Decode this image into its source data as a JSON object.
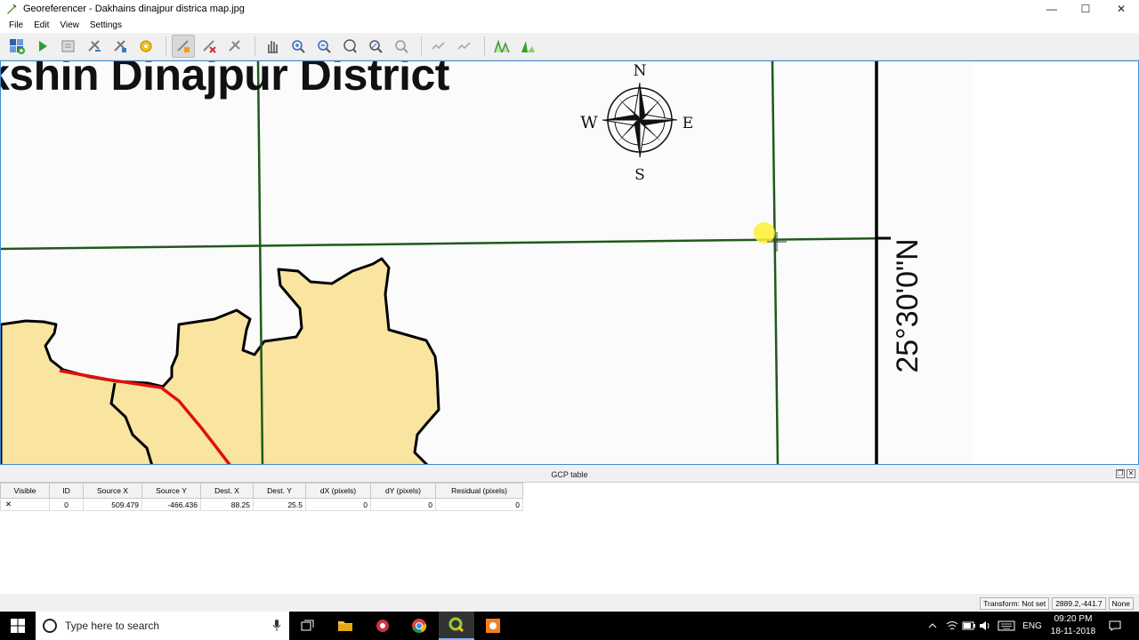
{
  "window": {
    "title": "Georeferencer - Dakhains dinajpur districa map.jpg",
    "minimize_glyph": "—",
    "maximize_glyph": "☐",
    "close_glyph": "✕"
  },
  "menu": [
    "File",
    "Edit",
    "View",
    "Settings"
  ],
  "toolbar_icons": [
    "open-raster-icon",
    "start-georeferencing-icon",
    "generate-gdal-script-icon",
    "load-gcp-icon",
    "save-gcp-icon",
    "transformation-settings-icon",
    "add-point-icon",
    "delete-point-icon",
    "move-gcp-icon",
    "pan-icon",
    "zoom-in-icon",
    "zoom-out-icon",
    "zoom-to-layer-icon",
    "zoom-last-icon",
    "zoom-next-icon",
    "link-georeferencer-icon",
    "link-qgis-icon",
    "full-histogram-stretch-icon",
    "local-histogram-stretch-icon"
  ],
  "map": {
    "title_text": "kshin Dinajpur District",
    "compass": {
      "n": "N",
      "s": "S",
      "e": "E",
      "w": "W"
    },
    "latitude_label": "25°30'0\"N",
    "colors": {
      "grid": "#1f5a1a",
      "district_fill": "#f9e4a0",
      "boundary": "#000000",
      "river": "#e01010",
      "cursor_highlight": "#ffee33"
    }
  },
  "gcp_panel": {
    "title": "GCP table",
    "columns": [
      "Visible",
      "ID",
      "Source X",
      "Source Y",
      "Dest. X",
      "Dest. Y",
      "dX (pixels)",
      "dY (pixels)",
      "Residual (pixels)"
    ],
    "rows": [
      {
        "visible": "✕",
        "id": "0",
        "source_x": "509.479",
        "source_y": "-466.436",
        "dest_x": "88.25",
        "dest_y": "25.5",
        "dx": "0",
        "dy": "0",
        "residual": "0"
      }
    ]
  },
  "status": {
    "transform": "Transform: Not set",
    "coords": "2889.2,-441.7",
    "units": "None"
  },
  "taskbar": {
    "search_placeholder": "Type here to search",
    "language": "ENG",
    "time": "09:20 PM",
    "date": "18-11-2018"
  }
}
